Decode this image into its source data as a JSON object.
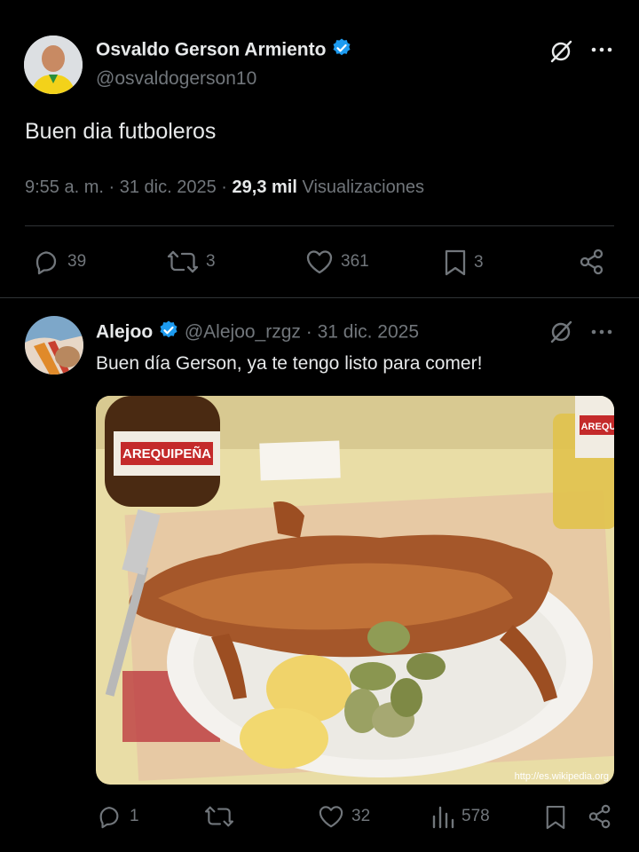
{
  "main_post": {
    "author_name": "Osvaldo Gerson Armiento",
    "handle": "@osvaldogerson10",
    "text": "Buen dia futboleros",
    "time": "9:55 a. m.",
    "date": "31 dic. 2025",
    "views_count": "29,3 mil",
    "views_label": "Visualizaciones",
    "replies": "39",
    "reposts": "3",
    "likes": "361",
    "bookmarks": "3"
  },
  "reply_post": {
    "author_name": "Alejoo",
    "handle": "@Alejoo_rzgz",
    "date": "31 dic. 2025",
    "separator": "·",
    "text": "Buen día Gerson, ya te tengo listo para comer!",
    "image_caption": "http://es.wikipedia.org",
    "bottle_label": "AREQUIPEÑA",
    "bottle_label_right": "AREQUI",
    "replies": "1",
    "likes": "32",
    "views": "578"
  },
  "colors": {
    "accent": "#1d9bf0",
    "muted": "#71767b",
    "background": "#000000"
  }
}
